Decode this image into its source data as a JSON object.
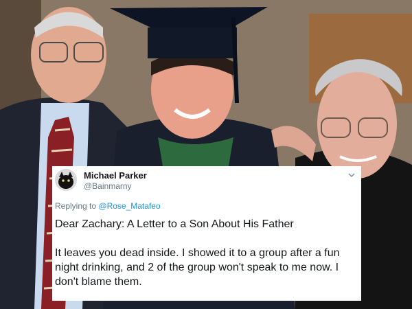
{
  "tweet": {
    "display_name": "Michael Parker",
    "handle": "@Bainmarny",
    "replying_prefix": "Replying to",
    "replying_mention": "@Rose_Matafeo",
    "body_line1": "Dear Zachary: A Letter to a Son About His Father",
    "body_para2": "It leaves you dead inside. I showed it to a group after a fun night drinking, and 2 of the group won't speak to me now. I don't blame them."
  },
  "icons": {
    "avatar": "cat-avatar-icon",
    "menu": "chevron-down-icon"
  },
  "colors": {
    "name": "#14171a",
    "muted": "#657786",
    "link": "#1b95e0",
    "card_bg": "#ffffff"
  }
}
